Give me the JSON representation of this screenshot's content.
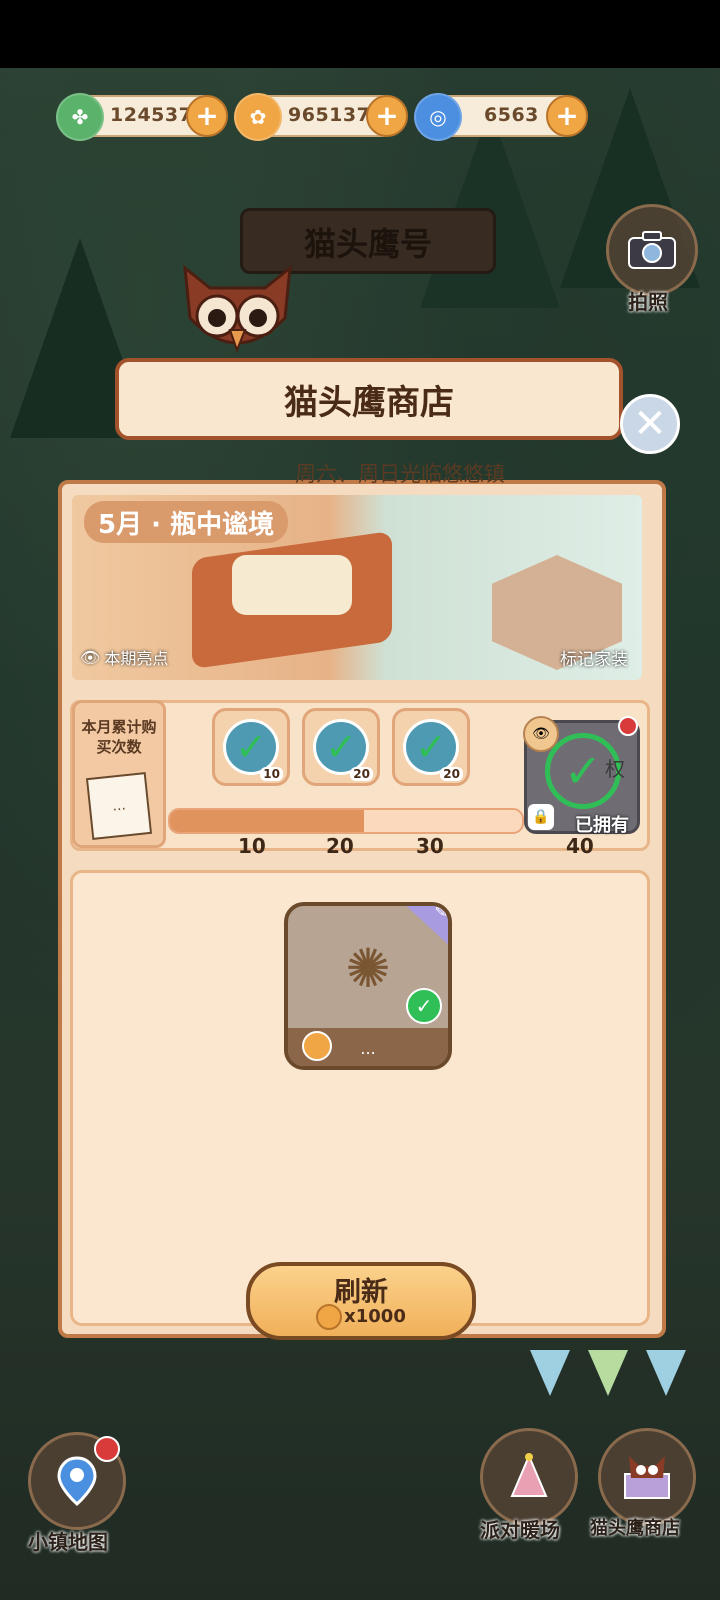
{
  "currencies": [
    {
      "value": "124537",
      "icon": "clover-icon",
      "color": "#5bb26a"
    },
    {
      "value": "965137",
      "icon": "coin-icon",
      "color": "#f0a645"
    },
    {
      "value": "6563",
      "icon": "swirl-icon",
      "color": "#4c8fe0"
    }
  ],
  "sign": "猫头鹰号",
  "camera_label": "拍照",
  "shop": {
    "title": "猫头鹰商店",
    "subtitle": "周六、周日光临悠悠镇",
    "theme": "5月 · 瓶中谧境",
    "highlight": "本期亮点",
    "mark_furniture": "标记家装"
  },
  "progress": {
    "card_label": "本月累计购买次数",
    "card_dots": "...",
    "fill_fraction": 0.55,
    "milestones": [
      {
        "badge": "10",
        "tick": "10"
      },
      {
        "badge": "20",
        "tick": "20"
      },
      {
        "badge": "20",
        "tick": "30"
      }
    ],
    "final": {
      "tick": "40",
      "owned": "已拥有",
      "partial_text": "权"
    }
  },
  "item": {
    "price": "...",
    "status": "owned"
  },
  "refresh": {
    "label": "刷新",
    "cost": "x1000"
  },
  "bottom_nav": {
    "map": "小镇地图",
    "party": "派对暖场",
    "owl_shop": "猫头鹰商店"
  },
  "colors": {
    "accent": "#f0a645",
    "panel": "#f5dcc0",
    "border": "#c07a47",
    "check": "#2fbf56"
  }
}
